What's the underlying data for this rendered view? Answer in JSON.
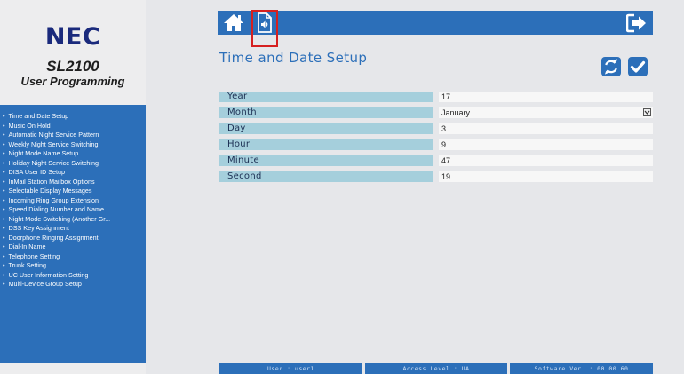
{
  "brand": {
    "logo": "NEC",
    "product": "SL2100",
    "subtitle": "User Programming"
  },
  "sidebar": {
    "items": [
      {
        "label": "Time and Date Setup"
      },
      {
        "label": "Music On Hold"
      },
      {
        "label": "Automatic Night Service Pattern"
      },
      {
        "label": "Weekly Night Service Switching"
      },
      {
        "label": "Night Mode Name Setup"
      },
      {
        "label": "Holiday Night Service Switching"
      },
      {
        "label": "DISA User ID Setup"
      },
      {
        "label": "InMail Station Mailbox Options"
      },
      {
        "label": "Selectable Display Messages"
      },
      {
        "label": "Incoming Ring Group Extension"
      },
      {
        "label": "Speed Dialing Number and Name"
      },
      {
        "label": "Night Mode Switching (Another Gr..."
      },
      {
        "label": "DSS Key Assignment"
      },
      {
        "label": "Doorphone Ringing Assignment"
      },
      {
        "label": "Dial-In Name"
      },
      {
        "label": "Telephone Setting"
      },
      {
        "label": "Trunk Setting"
      },
      {
        "label": "UC User Information Setting"
      },
      {
        "label": "Multi-Device Group Setup"
      }
    ]
  },
  "toolbar": {
    "home_icon": "home-icon",
    "music_icon": "music-file-icon",
    "logout_icon": "logout-icon",
    "highlight_color": "#d62020"
  },
  "page": {
    "title": "Time and Date Setup",
    "refresh_icon": "refresh-icon",
    "apply_icon": "checkmark-icon"
  },
  "form": {
    "rows": [
      {
        "label": "Year",
        "value": "17"
      },
      {
        "label": "Month",
        "value": "January"
      },
      {
        "label": "Day",
        "value": "3"
      },
      {
        "label": "Hour",
        "value": "9"
      },
      {
        "label": "Minute",
        "value": "47"
      },
      {
        "label": "Second",
        "value": "19"
      }
    ]
  },
  "status": {
    "user": "User : user1",
    "access": "Access Level : UA",
    "software": "Software Ver. : 00.00.60"
  },
  "colors": {
    "accent": "#2c6fb9",
    "label_bg": "#a5cfdc",
    "logo": "#1a2a7c"
  }
}
